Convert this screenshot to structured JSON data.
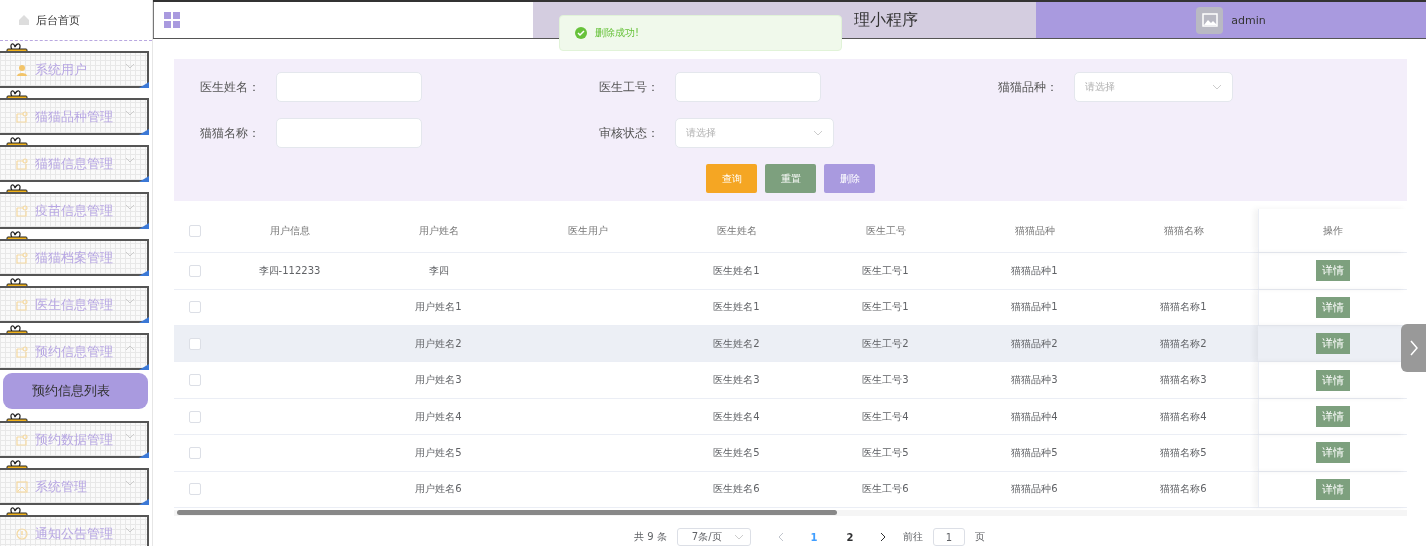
{
  "sidebar": {
    "home": "后台首页",
    "items": [
      {
        "label": "系统用户",
        "kind": "user",
        "expanded": false
      },
      {
        "label": "猫猫品种管理",
        "kind": "doc",
        "expanded": false
      },
      {
        "label": "猫猫信息管理",
        "kind": "doc",
        "expanded": false
      },
      {
        "label": "疫苗信息管理",
        "kind": "doc",
        "expanded": false
      },
      {
        "label": "猫猫档案管理",
        "kind": "doc",
        "expanded": false
      },
      {
        "label": "医生信息管理",
        "kind": "doc",
        "expanded": false
      },
      {
        "label": "预约信息管理",
        "kind": "doc",
        "expanded": true,
        "children": [
          {
            "label": "预约信息列表",
            "selected": true
          }
        ]
      },
      {
        "label": "预约数据管理",
        "kind": "doc",
        "expanded": false
      },
      {
        "label": "系统管理",
        "kind": "image",
        "expanded": false
      },
      {
        "label": "通知公告管理",
        "kind": "info",
        "expanded": false
      }
    ]
  },
  "header": {
    "title": "理小程序",
    "user": "admin"
  },
  "toast": {
    "message": "删除成功!",
    "kind": "success"
  },
  "search": {
    "fields": [
      {
        "label": "医生姓名：",
        "kind": "text"
      },
      {
        "label": "医生工号：",
        "kind": "text"
      },
      {
        "label": "猫猫品种：",
        "kind": "select",
        "placeholder": "请选择"
      },
      {
        "label": "猫猫名称：",
        "kind": "text"
      },
      {
        "label": "审核状态：",
        "kind": "select",
        "placeholder": "请选择"
      }
    ],
    "buttons": [
      {
        "label": "查询",
        "kind": "search"
      },
      {
        "label": "重置",
        "kind": "reset"
      },
      {
        "label": "删除",
        "kind": "delete"
      }
    ]
  },
  "table": {
    "checked": false,
    "columns": [
      "用户信息",
      "用户姓名",
      "医生用户",
      "医生姓名",
      "医生工号",
      "猫猫品种",
      "猫猫名称",
      "操作"
    ],
    "rows": [
      {
        "checked": false,
        "hovered": false,
        "cells": [
          "李四-112233",
          "李四",
          null,
          "医生姓名1",
          "医生工号1",
          "猫猫品种1",
          null
        ],
        "action": "详情"
      },
      {
        "checked": false,
        "hovered": false,
        "cells": [
          null,
          "用户姓名1",
          null,
          "医生姓名1",
          "医生工号1",
          "猫猫品种1",
          "猫猫名称1"
        ],
        "action": "详情"
      },
      {
        "checked": false,
        "hovered": true,
        "cells": [
          null,
          "用户姓名2",
          null,
          "医生姓名2",
          "医生工号2",
          "猫猫品种2",
          "猫猫名称2"
        ],
        "action": "详情"
      },
      {
        "checked": false,
        "hovered": false,
        "cells": [
          null,
          "用户姓名3",
          null,
          "医生姓名3",
          "医生工号3",
          "猫猫品种3",
          "猫猫名称3"
        ],
        "action": "详情"
      },
      {
        "checked": false,
        "hovered": false,
        "cells": [
          null,
          "用户姓名4",
          null,
          "医生姓名4",
          "医生工号4",
          "猫猫品种4",
          "猫猫名称4"
        ],
        "action": "详情"
      },
      {
        "checked": false,
        "hovered": false,
        "cells": [
          null,
          "用户姓名5",
          null,
          "医生姓名5",
          "医生工号5",
          "猫猫品种5",
          "猫猫名称5"
        ],
        "action": "详情"
      },
      {
        "checked": false,
        "hovered": false,
        "cells": [
          null,
          "用户姓名6",
          null,
          "医生姓名6",
          "医生工号6",
          "猫猫品种6",
          "猫猫名称6"
        ],
        "action": "详情"
      }
    ]
  },
  "pagination": {
    "total": "共 9 条",
    "page_size": "7条/页",
    "pages": [
      {
        "label": "1",
        "selected": true
      },
      {
        "label": "2",
        "selected": false
      }
    ],
    "goto_label": "前往",
    "goto_value": "1",
    "goto_suffix": "页"
  }
}
